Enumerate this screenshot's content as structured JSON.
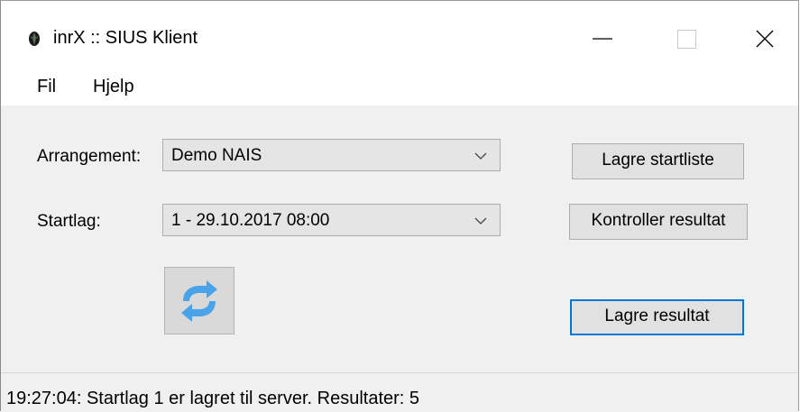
{
  "window": {
    "title": "inrX :: SIUS Klient",
    "icon": "app-logo-icon",
    "controls": [
      "minimize-icon",
      "maximize-icon",
      "close-icon"
    ]
  },
  "menu": {
    "items": [
      "Fil",
      "Hjelp"
    ]
  },
  "form": {
    "arrangement_label": "Arrangement:",
    "arrangement_value": "Demo NAIS",
    "startlag_label": "Startlag:",
    "startlag_value": "1 - 29.10.2017 08:00",
    "refresh_icon": "refresh-icon"
  },
  "buttons": {
    "save_startlist": "Lagre startliste",
    "check_result": "Kontroller resultat",
    "save_result": "Lagre resultat"
  },
  "status": {
    "text": "19:27:04: Startlag 1 er lagret til server. Resultater: 5"
  },
  "colors": {
    "accent": "#0078d7",
    "refresh_blue": "#4aa3e8",
    "background": "#f0f0f0"
  }
}
